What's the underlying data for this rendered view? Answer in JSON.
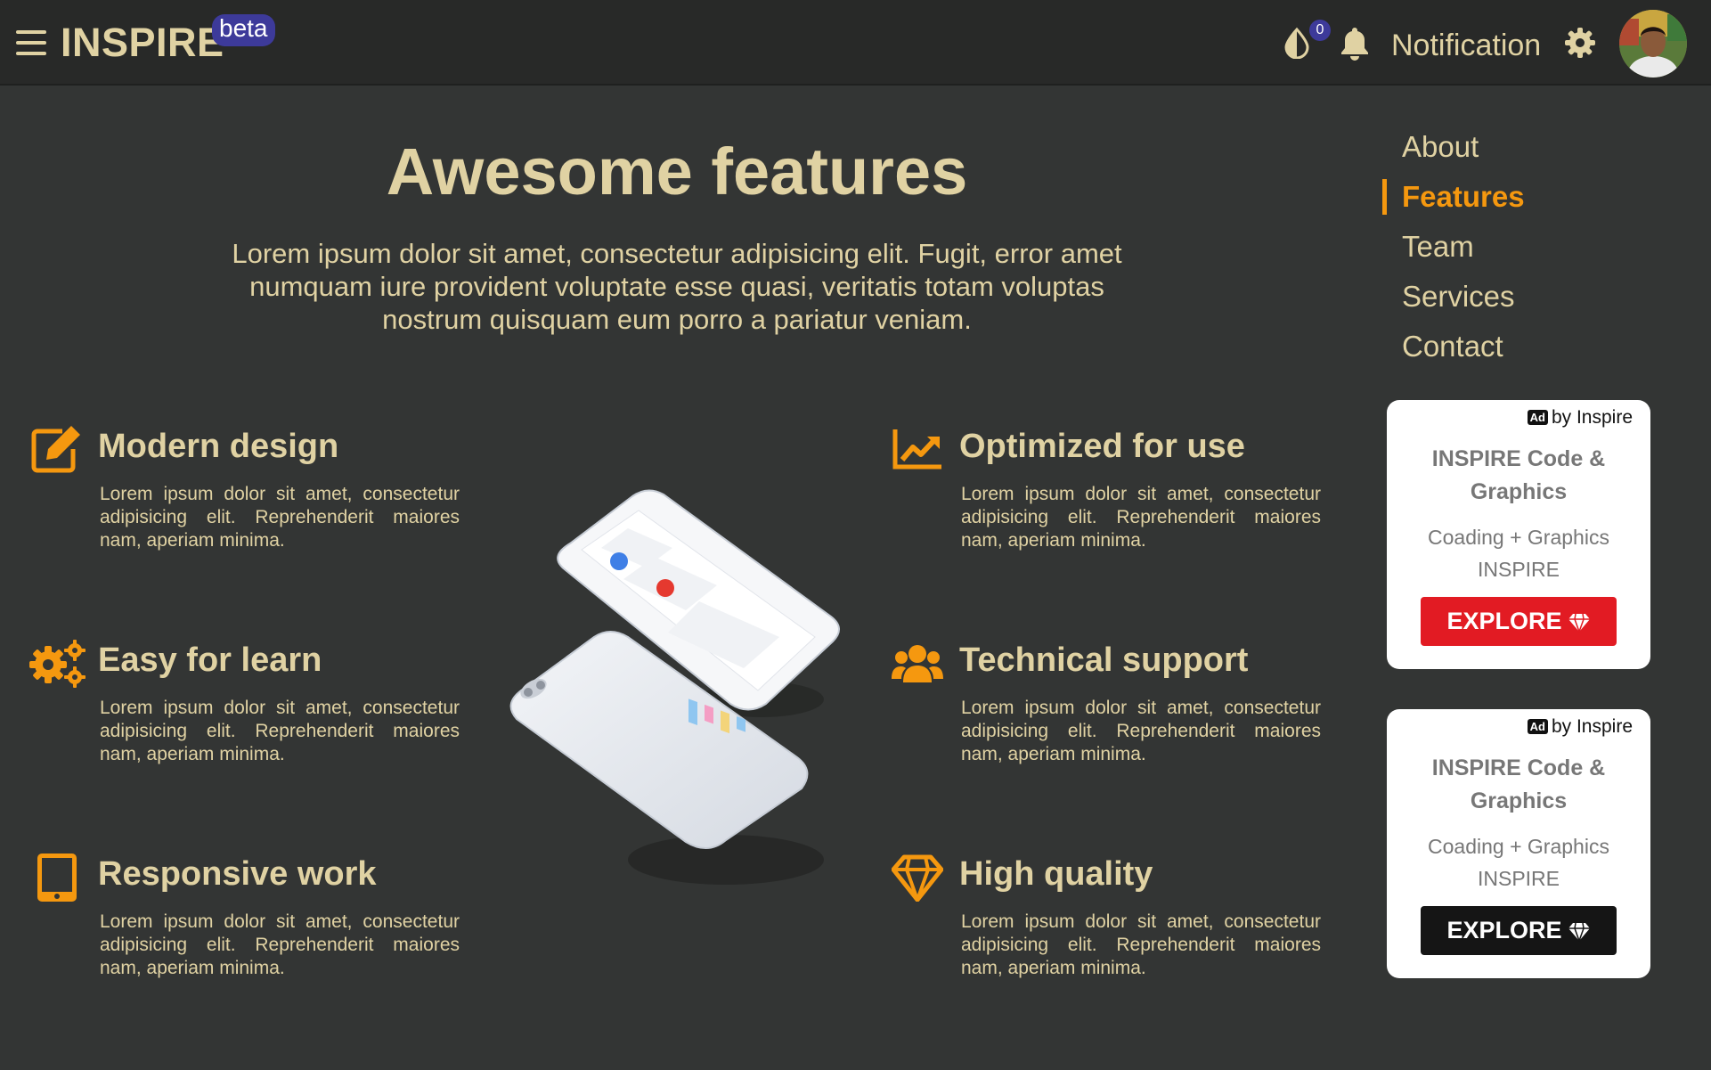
{
  "header": {
    "brand": "INSPIRE",
    "beta": "beta",
    "contrast_count": "0",
    "notification_label": "Notification",
    "icons": [
      "menu-icon",
      "contrast-icon",
      "bell-icon",
      "settings-gear-icon",
      "avatar"
    ]
  },
  "hero": {
    "title": "Awesome features",
    "subtitle": "Lorem ipsum dolor sit amet, consectetur adipisicing elit. Fugit, error amet numquam iure provident voluptate esse quasi, veritatis totam voluptas nostrum quisquam eum porro a pariatur veniam."
  },
  "sidenav": {
    "items": [
      {
        "label": "About",
        "active": false
      },
      {
        "label": "Features",
        "active": true
      },
      {
        "label": "Team",
        "active": false
      },
      {
        "label": "Services",
        "active": false
      },
      {
        "label": "Contact",
        "active": false
      }
    ]
  },
  "ads": [
    {
      "badge": "Ad",
      "by": "by Inspire",
      "title": "INSPIRE Code & Graphics",
      "desc": "Coading + Graphics INSPIRE",
      "button": "EXPLORE",
      "button_color": "#e21b23"
    },
    {
      "badge": "Ad",
      "by": "by Inspire",
      "title": "INSPIRE Code & Graphics",
      "desc": "Coading + Graphics INSPIRE",
      "button": "EXPLORE",
      "button_color": "#151515"
    }
  ],
  "features": [
    {
      "title": "Modern design",
      "icon": "edit-icon",
      "text": "Lorem ipsum dolor sit amet, consectetur adipisicing elit. Reprehenderit maiores nam, aperiam minima."
    },
    {
      "title": "Easy for learn",
      "icon": "gears-icon",
      "text": "Lorem ipsum dolor sit amet, consectetur adipisicing elit. Reprehenderit maiores nam, aperiam minima."
    },
    {
      "title": "Responsive work",
      "icon": "tablet-icon",
      "text": "Lorem ipsum dolor sit amet, consectetur adipisicing elit. Reprehenderit maiores nam, aperiam minima."
    },
    {
      "title": "Optimized for use",
      "icon": "chart-line-icon",
      "text": "Lorem ipsum dolor sit amet, consectetur adipisicing elit. Reprehenderit maiores nam, aperiam minima."
    },
    {
      "title": "Technical support",
      "icon": "users-icon",
      "text": "Lorem ipsum dolor sit amet, consectetur adipisicing elit. Reprehenderit maiores nam, aperiam minima."
    },
    {
      "title": "High quality",
      "icon": "diamond-icon",
      "text": "Lorem ipsum dolor sit amet, consectetur adipisicing elit. Reprehenderit maiores nam, aperiam minima."
    }
  ],
  "colors": {
    "background": "#333534",
    "header": "#282928",
    "text": "#e0d2a3",
    "accent": "#f5980f",
    "badge": "#3d3a9a"
  }
}
